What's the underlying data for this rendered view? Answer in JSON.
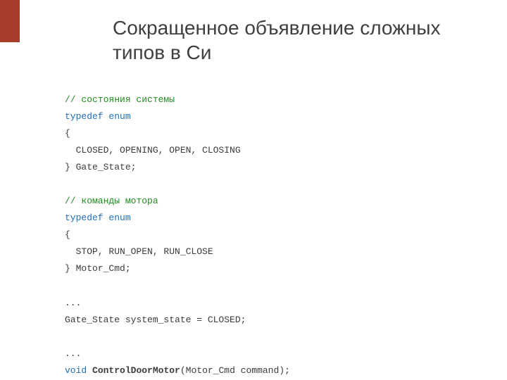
{
  "title": "Сокращенное объявление сложных типов в Си",
  "code": {
    "c1": "// состояния системы",
    "kw1": "typedef enum",
    "brace_open1": "{",
    "enum1": "  CLOSED, OPENING, OPEN, CLOSING",
    "brace_close1": "} Gate_State;",
    "c2": "// команды мотора",
    "kw2": "typedef enum",
    "brace_open2": "{",
    "enum2": "  STOP, RUN_OPEN, RUN_CLOSE",
    "brace_close2": "} Motor_Cmd;",
    "ellipsis1": "...",
    "decl1": "Gate_State system_state = CLOSED;",
    "ellipsis2": "...",
    "fn_ret": "void",
    "fn_name": "ControlDoorMotor",
    "fn_args": "(Motor_Cmd command);"
  }
}
